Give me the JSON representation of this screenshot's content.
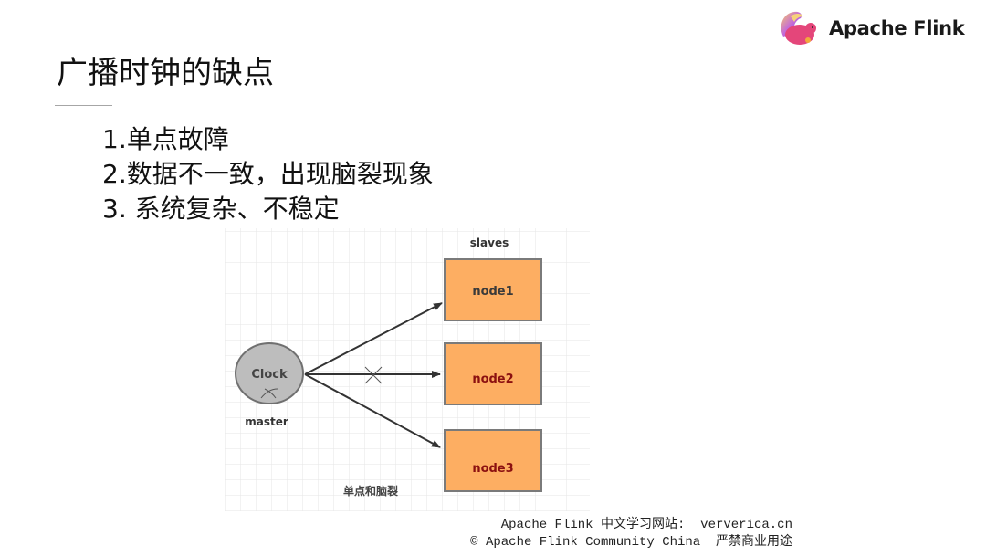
{
  "brand": {
    "logo_icon": "flink-squirrel-logo",
    "name": "Apache Flink"
  },
  "slide": {
    "title": "广播时钟的缺点",
    "points": [
      "1.单点故障",
      "2.数据不一致，出现脑裂现象",
      "3. 系统复杂、不稳定"
    ]
  },
  "diagram": {
    "master": {
      "label": "Clock",
      "role": "master",
      "failed": true
    },
    "slaves_label": "slaves",
    "nodes": [
      {
        "label": "node1",
        "label_color": "#3a3a3a",
        "link_broken": false
      },
      {
        "label": "node2",
        "label_color": "#8b1010",
        "link_broken": true
      },
      {
        "label": "node3",
        "label_color": "#8b1010",
        "link_broken": false
      }
    ],
    "caption": "单点和脑裂",
    "colors": {
      "node_fill": "#fdae62",
      "node_border": "#7a7a7a",
      "master_fill": "#bdbdbd",
      "grid": "#e6e6e6"
    }
  },
  "footer": {
    "line1": "Apache Flink 中文学习网站:  ververica.cn",
    "line2": "© Apache Flink Community China  严禁商业用途"
  }
}
